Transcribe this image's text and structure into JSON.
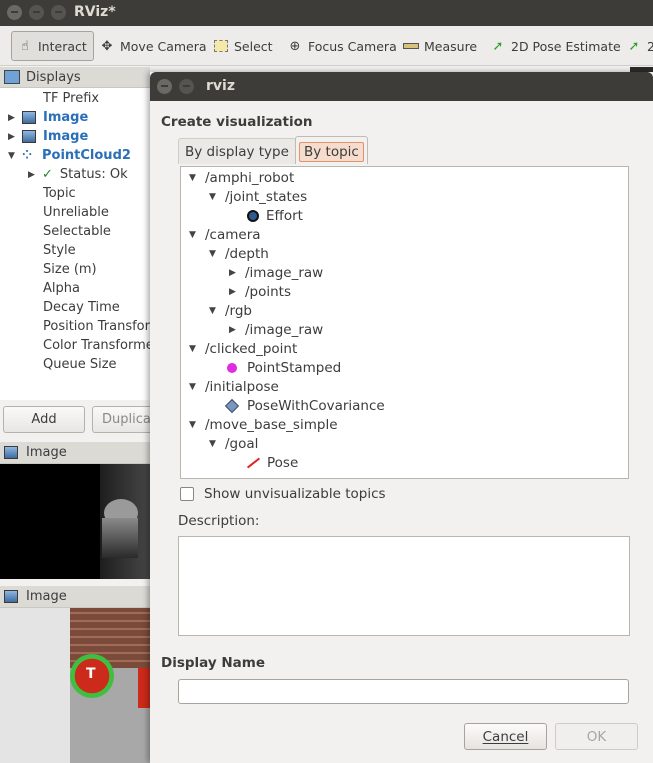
{
  "window": {
    "title": "RViz*"
  },
  "toolbar": {
    "tools": [
      {
        "label": "Interact",
        "icon": "hand-pointer-icon"
      },
      {
        "label": "Move Camera",
        "icon": "move-camera-icon"
      },
      {
        "label": "Select",
        "icon": "select-icon"
      },
      {
        "label": "Focus Camera",
        "icon": "focus-camera-icon"
      },
      {
        "label": "Measure",
        "icon": "ruler-icon"
      },
      {
        "label": "2D Pose Estimate",
        "icon": "pose-arrow-icon"
      },
      {
        "label": "2",
        "icon": "pose-arrow-icon"
      }
    ]
  },
  "displays": {
    "header": "Displays",
    "items": [
      {
        "label": "TF Prefix"
      },
      {
        "label": "Image"
      },
      {
        "label": "Image"
      },
      {
        "label": "PointCloud2"
      },
      {
        "label": "Status: Ok"
      },
      {
        "label": "Topic"
      },
      {
        "label": "Unreliable"
      },
      {
        "label": "Selectable"
      },
      {
        "label": "Style"
      },
      {
        "label": "Size (m)"
      },
      {
        "label": "Alpha"
      },
      {
        "label": "Decay Time"
      },
      {
        "label": "Position Transformer"
      },
      {
        "label": "Color Transformer"
      },
      {
        "label": "Queue Size"
      }
    ],
    "add_label": "Add",
    "duplicate_label": "Duplicate"
  },
  "image_panels": [
    {
      "title": "Image"
    },
    {
      "title": "Image"
    }
  ],
  "dialog": {
    "title": "rviz",
    "heading": "Create visualization",
    "tabs": [
      {
        "label": "By display type",
        "selected": false
      },
      {
        "label": "By topic",
        "selected": true
      }
    ],
    "tree": [
      {
        "label": "/amphi_robot"
      },
      {
        "label": "/joint_states"
      },
      {
        "label": "Effort"
      },
      {
        "label": "/camera"
      },
      {
        "label": "/depth"
      },
      {
        "label": "/image_raw"
      },
      {
        "label": "/points"
      },
      {
        "label": "/rgb"
      },
      {
        "label": "/image_raw"
      },
      {
        "label": "/clicked_point"
      },
      {
        "label": "PointStamped"
      },
      {
        "label": "/initialpose"
      },
      {
        "label": "PoseWithCovariance"
      },
      {
        "label": "/move_base_simple"
      },
      {
        "label": "/goal"
      },
      {
        "label": "Pose"
      }
    ],
    "show_unvisualizable_label": "Show unvisualizable topics",
    "show_unvisualizable_checked": false,
    "description_label": "Description:",
    "description_value": "",
    "display_name_label": "Display Name",
    "display_name_value": "",
    "cancel_label": "Cancel",
    "ok_label": "OK"
  },
  "colors": {
    "titlebar": "#3d3c38",
    "link_blue": "#2a6fb8",
    "selected_tab": "#f6dccd",
    "point_stamped": "#e02be0",
    "pose_arrow": "#dd2222"
  }
}
